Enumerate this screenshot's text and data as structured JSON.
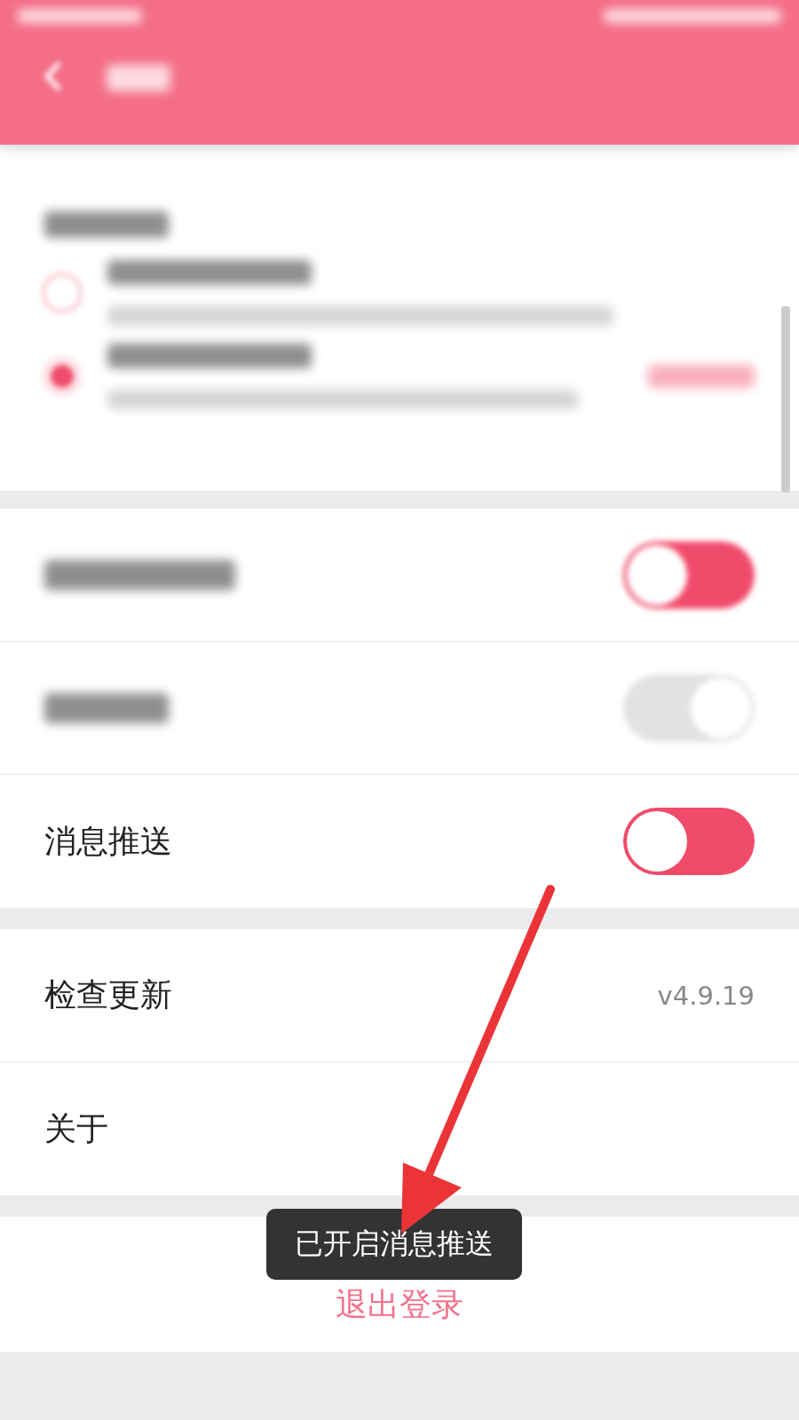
{
  "download_options": [
    {
      "selected": false
    },
    {
      "selected": true
    }
  ],
  "toggle_rows": [
    {
      "label": null,
      "on": true
    },
    {
      "label": null,
      "on": false
    },
    {
      "label": "消息推送",
      "on": true
    }
  ],
  "info_rows": [
    {
      "label": "检查更新",
      "value": "v4.9.19"
    },
    {
      "label": "关于"
    }
  ],
  "logout": "退出登录",
  "toast": "已开启消息推送"
}
